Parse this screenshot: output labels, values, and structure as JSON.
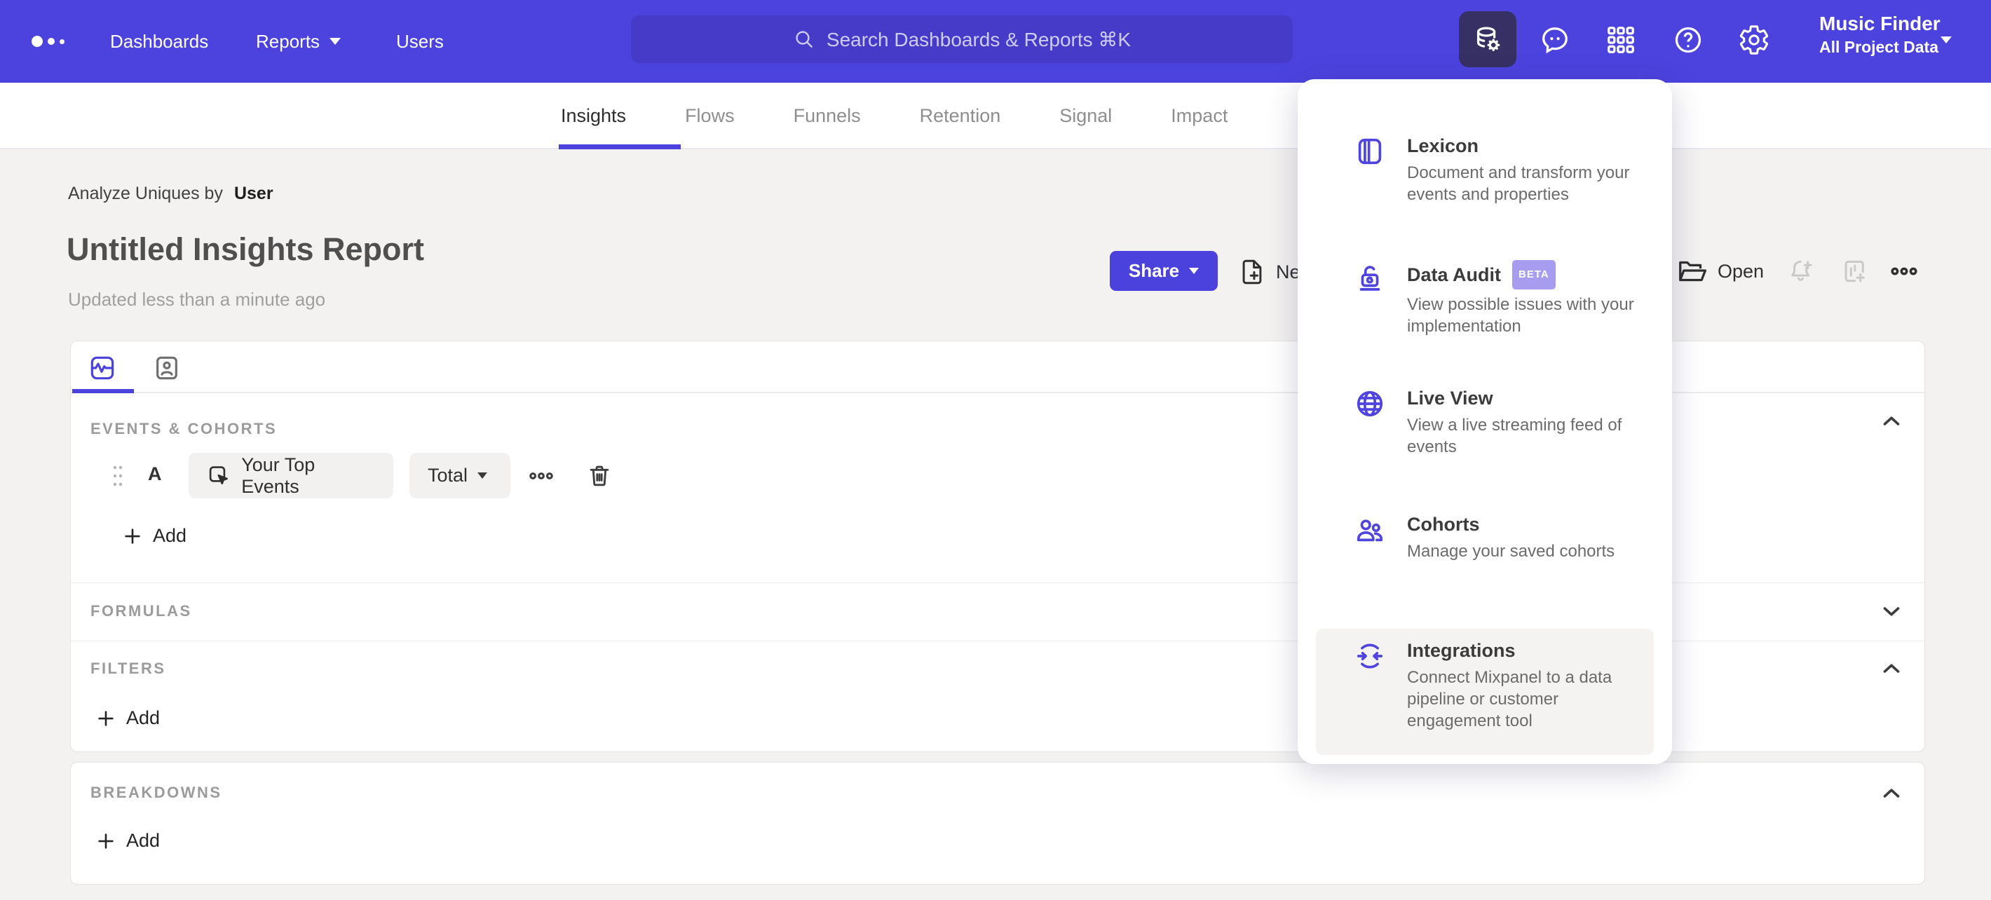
{
  "colors": {
    "nav_bg": "#4C43DF",
    "nav_search_bg": "#453BC8",
    "nav_active_icon_bg": "#363064",
    "accent": "#4B42DE",
    "accent_icon": "#4F44E0",
    "beta_badge_bg": "#A89CF0",
    "page_bg": "#F3F2F1",
    "chip_bg": "#F2F1EF",
    "menu_hover_bg": "#F4F3F2"
  },
  "nav": {
    "items": [
      {
        "label": "Dashboards"
      },
      {
        "label": "Reports"
      },
      {
        "label": "Users"
      }
    ],
    "search_placeholder": "Search Dashboards & Reports ⌘K",
    "icons": [
      "data-management",
      "feedback",
      "apps-grid",
      "help",
      "settings"
    ],
    "project": {
      "name": "Music Finder",
      "scope": "All Project Data"
    }
  },
  "tabbar": {
    "tabs": [
      {
        "label": "Insights"
      },
      {
        "label": "Flows"
      },
      {
        "label": "Funnels"
      },
      {
        "label": "Retention"
      },
      {
        "label": "Signal"
      },
      {
        "label": "Impact"
      }
    ],
    "active": "Insights"
  },
  "report_header": {
    "analyze_label": "Analyze Uniques by",
    "analyze_value": "User",
    "title": "Untitled Insights Report",
    "updated": "Updated less than a minute ago",
    "share_label": "Share",
    "new_label": "New",
    "open_label": "Open"
  },
  "query_builder": {
    "events_section_label": "EVENTS & COHORTS",
    "row": {
      "letter": "A",
      "event": "Your Top Events",
      "metric": "Total"
    },
    "add_label": "Add",
    "formulas_label": "FORMULAS",
    "filters_label": "FILTERS",
    "breakdowns_label": "BREAKDOWNS"
  },
  "menu": {
    "items": [
      {
        "title": "Lexicon",
        "desc": "Document and transform your events and properties"
      },
      {
        "title": "Data Audit",
        "badge": "BETA",
        "desc": "View possible issues with your implementation"
      },
      {
        "title": "Live View",
        "desc": "View a live streaming feed of events"
      },
      {
        "title": "Cohorts",
        "desc": "Manage your saved cohorts"
      },
      {
        "title": "Integrations",
        "desc": "Connect Mixpanel to a data pipeline or customer engagement tool"
      }
    ]
  }
}
